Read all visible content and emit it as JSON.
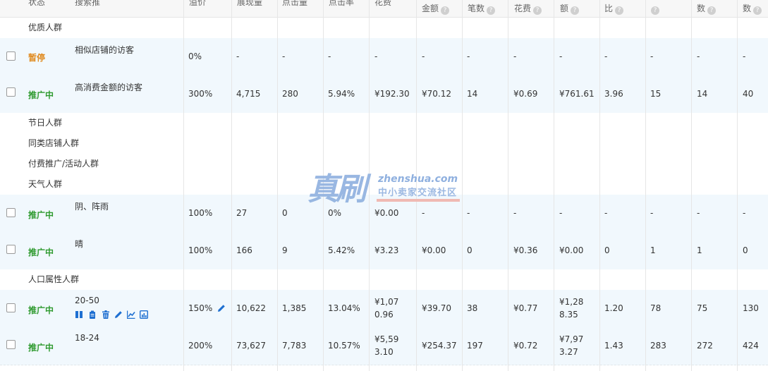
{
  "columns": [
    "状态",
    "搜索推",
    "溢价",
    "展现量",
    "点击量",
    "点击率",
    "花费",
    "金额",
    "笔数",
    "花费",
    "额",
    "比",
    "",
    "数",
    "数"
  ],
  "groups": {
    "quality": "优质人群",
    "holiday": "节日人群",
    "similar": "同类店铺人群",
    "paid": "付费推广/活动人群",
    "weather": "天气人群",
    "demographic": "人口属性人群"
  },
  "rows": [
    {
      "status": "暂停",
      "status_type": "paused",
      "name": "相似店铺的访客",
      "premium": "0%",
      "impressions": "-",
      "clicks": "-",
      "ctr": "-",
      "cost": "-",
      "amount": "-",
      "count": "-",
      "cpc": "-",
      "gmv": "-",
      "ratio": "-",
      "c12": "-",
      "c13": "-",
      "c14": "-"
    },
    {
      "status": "推广中",
      "status_type": "active",
      "name": "高消费金额的访客",
      "premium": "300%",
      "impressions": "4,715",
      "clicks": "280",
      "ctr": "5.94%",
      "cost": "¥192.30",
      "amount": "¥70.12",
      "count": "14",
      "cpc": "¥0.69",
      "gmv": "¥761.61",
      "ratio": "3.96",
      "c12": "15",
      "c13": "14",
      "c14": "40"
    },
    {
      "status": "推广中",
      "status_type": "active",
      "name": "阴、阵雨",
      "premium": "100%",
      "impressions": "27",
      "clicks": "0",
      "ctr": "0%",
      "cost": "¥0.00",
      "amount": "-",
      "count": "-",
      "cpc": "-",
      "gmv": "-",
      "ratio": "-",
      "c12": "-",
      "c13": "-",
      "c14": "-"
    },
    {
      "status": "推广中",
      "status_type": "active",
      "name": "晴",
      "premium": "100%",
      "impressions": "166",
      "clicks": "9",
      "ctr": "5.42%",
      "cost": "¥3.23",
      "amount": "¥0.00",
      "count": "0",
      "cpc": "¥0.36",
      "gmv": "¥0.00",
      "ratio": "0",
      "c12": "1",
      "c13": "1",
      "c14": "0"
    },
    {
      "status": "推广中",
      "status_type": "active",
      "name": "20-50",
      "premium": "150%",
      "impressions": "10,622",
      "clicks": "1,385",
      "ctr": "13.04%",
      "cost_line1": "¥1,07",
      "cost_line2": "0.96",
      "amount": "¥39.70",
      "count": "38",
      "cpc": "¥0.77",
      "gmv_line1": "¥1,28",
      "gmv_line2": "8.35",
      "ratio": "1.20",
      "c12": "78",
      "c13": "75",
      "c14": "130"
    },
    {
      "status": "推广中",
      "status_type": "active",
      "name": "18-24",
      "premium": "200%",
      "impressions": "73,627",
      "clicks": "7,783",
      "ctr": "10.57%",
      "cost_line1": "¥5,59",
      "cost_line2": "3.10",
      "amount": "¥254.37",
      "count": "197",
      "cpc": "¥0.72",
      "gmv_line1": "¥7,97",
      "gmv_line2": "3.27",
      "ratio": "1.43",
      "c12": "283",
      "c13": "272",
      "c14": "424"
    }
  ],
  "row_icons": [
    "pause-icon",
    "clipboard-icon",
    "trash-icon",
    "edit-icon",
    "chart-icon",
    "report-icon"
  ],
  "watermark": {
    "logo": "真刷",
    "url": "zhenshua.com",
    "text": "中小卖家交流社区"
  },
  "colors": {
    "paused": "#e08a1e",
    "active": "#2f9a2f",
    "icon": "#1e6fd1",
    "row_bg": "#f1f8fd"
  }
}
